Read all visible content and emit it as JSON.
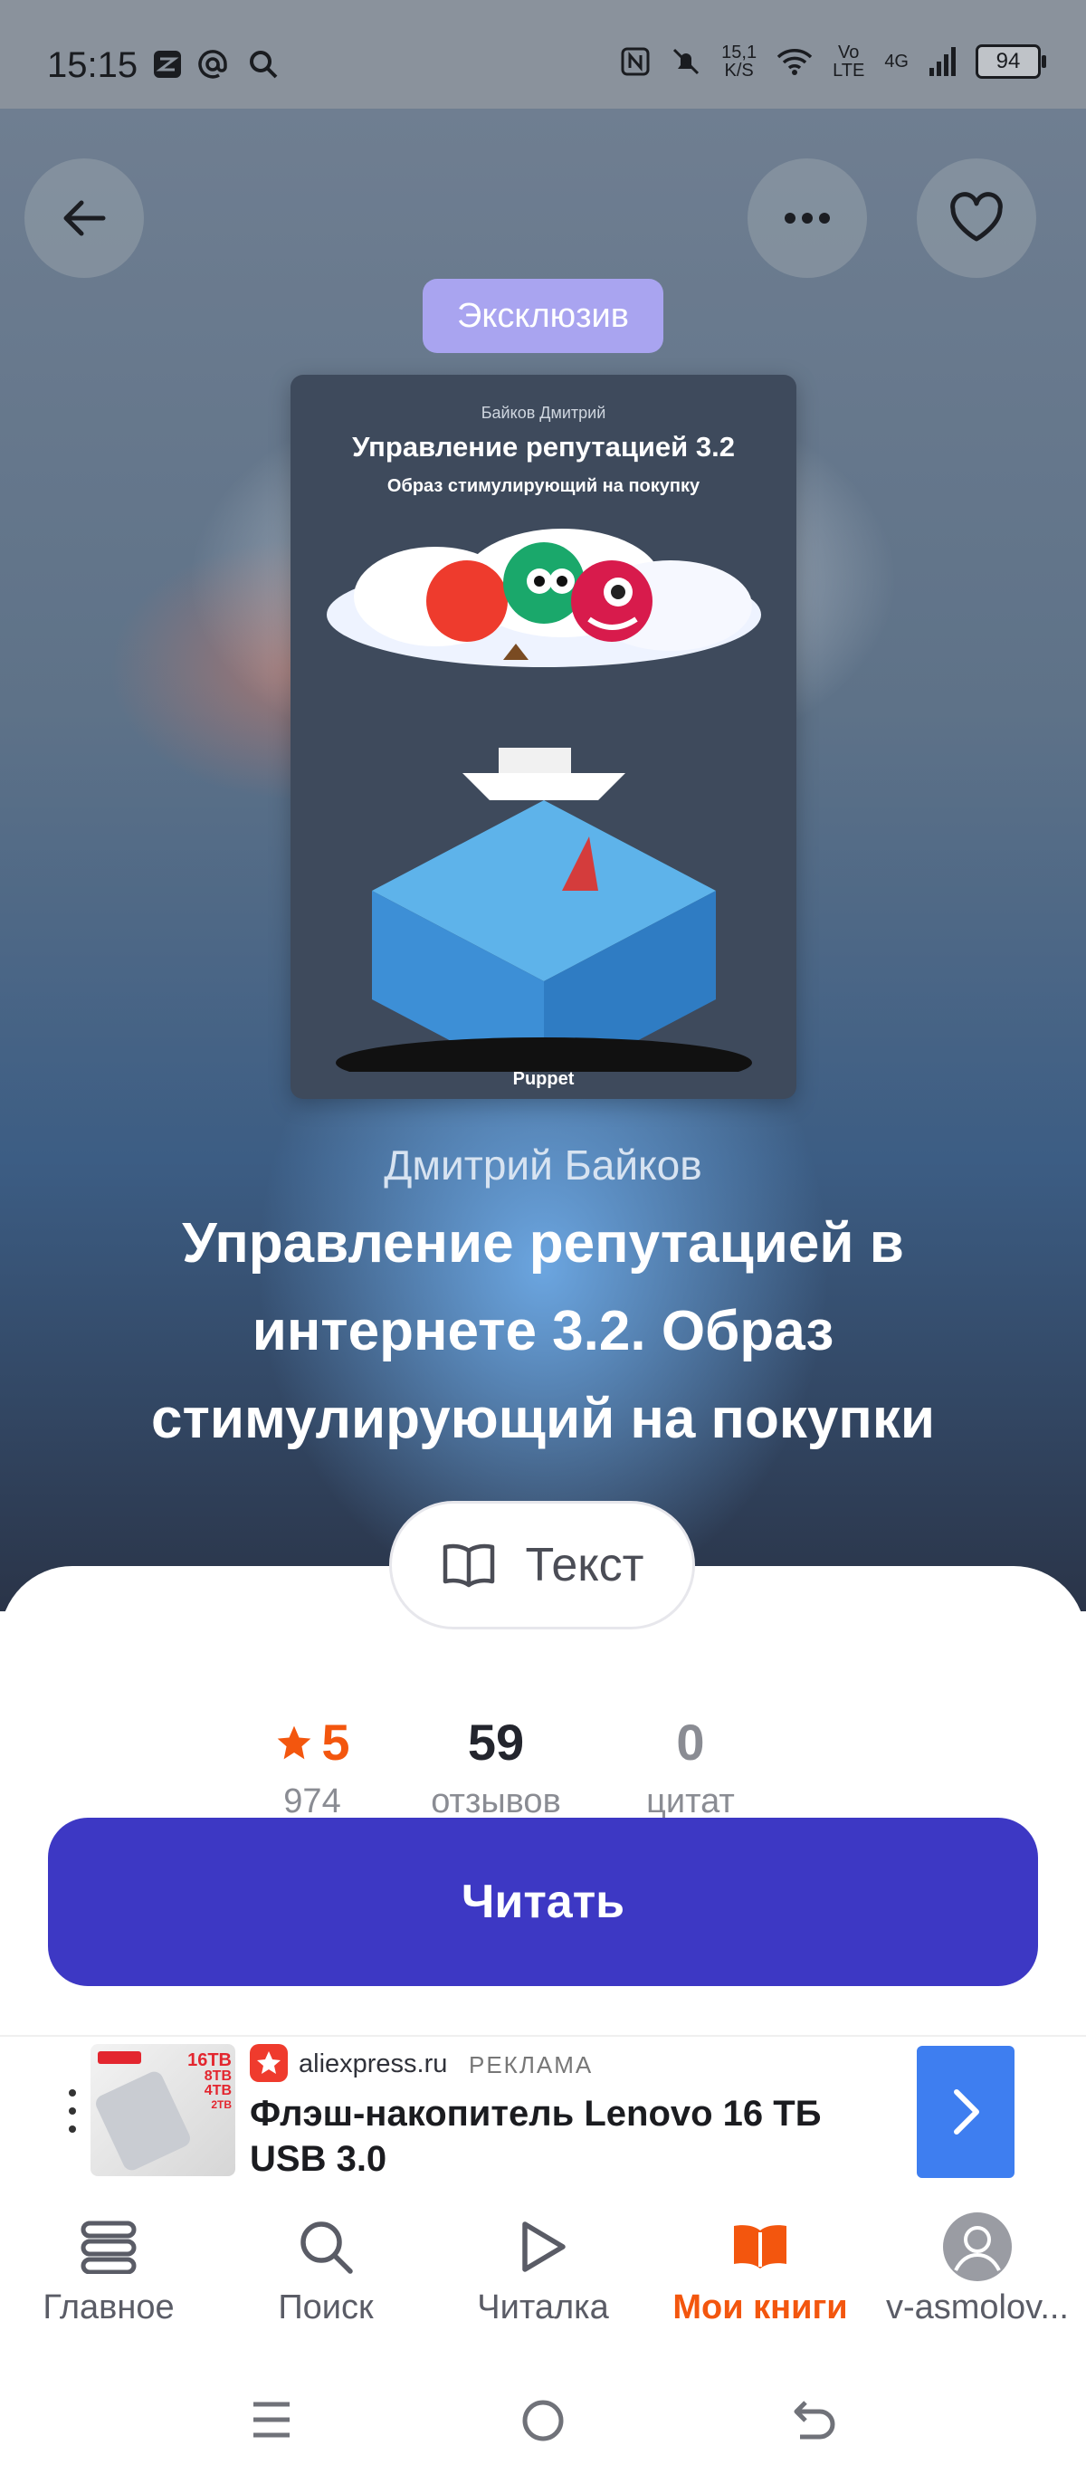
{
  "status_bar": {
    "time": "15:15",
    "network_speed": "15,1\nK/S",
    "volte": "Vo\nLTE",
    "net_type": "4G",
    "battery": "94"
  },
  "header": {
    "back_icon": "arrow-left-icon",
    "more_icon": "more-horizontal-icon",
    "favorite_icon": "heart-icon"
  },
  "badge": "Эксклюзив",
  "cover": {
    "author": "Байков Дмитрий",
    "title": "Управление репутацией 3.2",
    "subtitle": "Образ стимулирующий на покупку",
    "publisher": "Puppet"
  },
  "book": {
    "author": "Дмитрий Байков",
    "title": "Управление репутацией в интернете 3.2. Образ стимулирующий на покупки"
  },
  "format_pill": {
    "icon": "open-book-icon",
    "label": "Текст"
  },
  "stats": [
    {
      "value": "5",
      "label": "974",
      "icon": "star-icon"
    },
    {
      "value": "59",
      "label": "отзывов"
    },
    {
      "value": "0",
      "label": "цитат"
    }
  ],
  "read_button": "Читать",
  "ad": {
    "domain": "aliexpress.ru",
    "label": "РЕКЛАМА",
    "title": "Флэш-накопитель Lenovo 16 ТБ USB 3.0",
    "thumb_text": [
      "16TB",
      "8TB",
      "4TB",
      "2TB"
    ]
  },
  "tabs": [
    {
      "label": "Главное",
      "icon": "home-stack-icon",
      "active": false
    },
    {
      "label": "Поиск",
      "icon": "search-icon",
      "active": false
    },
    {
      "label": "Читалка",
      "icon": "play-icon",
      "active": false
    },
    {
      "label": "Мои книги",
      "icon": "book-open-icon",
      "active": true
    },
    {
      "label": "v-asmolov...",
      "icon": "avatar-icon",
      "active": false
    }
  ],
  "colors": {
    "accent": "#3d38c4",
    "star": "#f3560e",
    "active_tab": "#f3560e",
    "badge": "#a9a4f0",
    "ad_arrow": "#3e7ef0"
  }
}
